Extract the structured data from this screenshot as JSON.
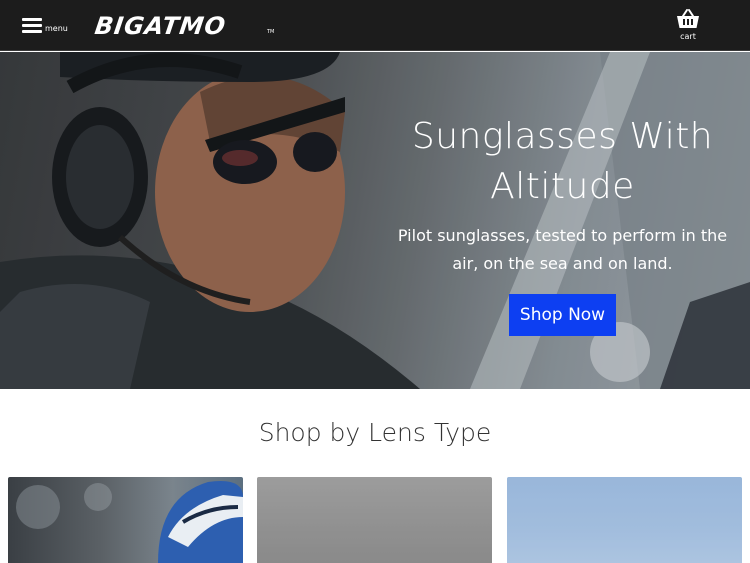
{
  "header": {
    "menu_label": "menu",
    "logo_text": "BIGATMO",
    "logo_tm": "TM",
    "cart_label": "cart",
    "background": "#1c1c1c"
  },
  "hero": {
    "title": "Sunglasses With Altitude",
    "subtitle": "Pilot sunglasses, tested to perform in the air, on the sea and on land.",
    "cta_label": "Shop Now",
    "cta_color": "#0d3ff2",
    "image_icon": "pilot-headset-photo"
  },
  "lens_section": {
    "title": "Shop by Lens Type",
    "cards": [
      {
        "image_icon": "cyclist-helmet-photo"
      },
      {
        "image_icon": "grey-lens-photo"
      },
      {
        "image_icon": "sky-lens-photo"
      }
    ]
  }
}
